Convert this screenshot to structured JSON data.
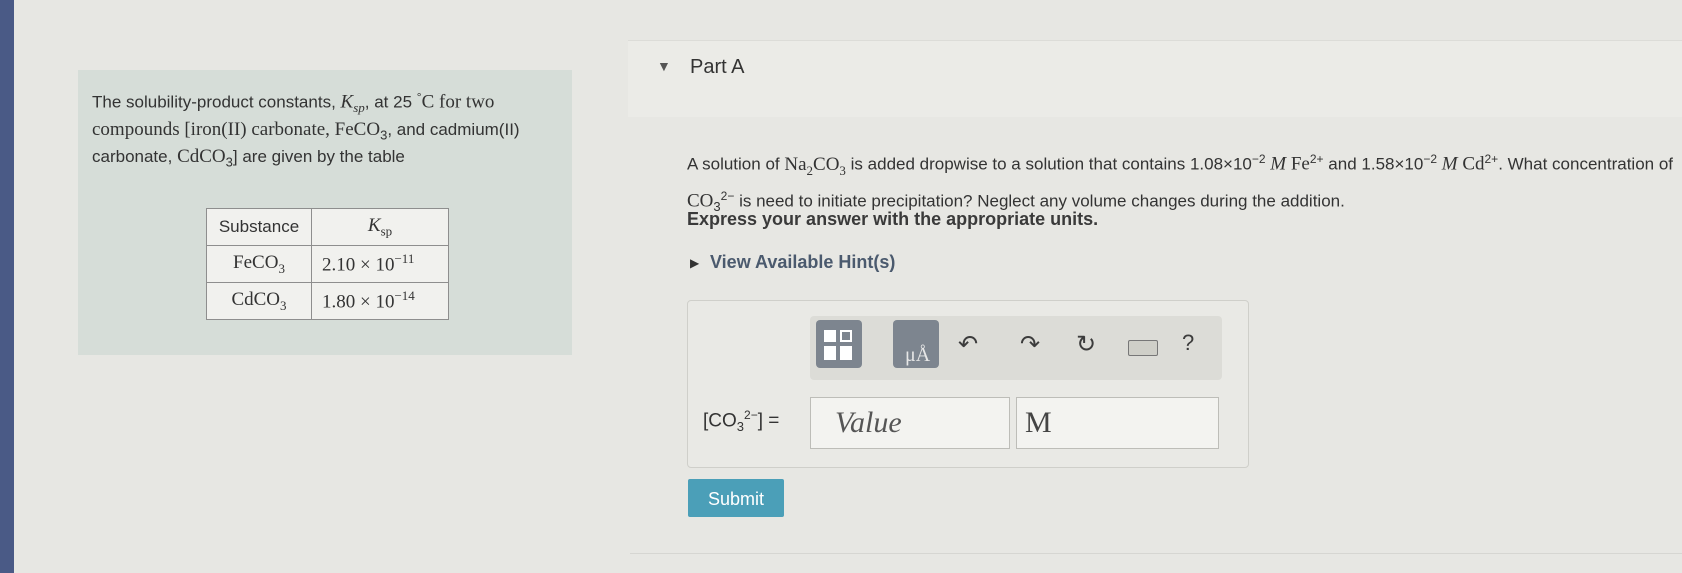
{
  "intro": {
    "text_1": "The solubility-product constants,",
    "ksp_k": "K",
    "ksp_sub": "sp",
    "text_2": ", at 25",
    "deg": "°",
    "unit_c": "C for two compounds [iron(II) carbonate,",
    "feco3": "FeCO",
    "sub3": "3",
    "text_3": ", and cadmium(II) carbonate,",
    "cdco3": "CdCO",
    "text_4": "] are given by the table"
  },
  "table": {
    "header_substance": "Substance",
    "header_ksp_k": "K",
    "header_ksp_sub": "sp",
    "rows": [
      {
        "formula": "FeCO",
        "sub": "3",
        "mantissa": "2.10 × 10",
        "exp": "−11"
      },
      {
        "formula": "CdCO",
        "sub": "3",
        "mantissa": "1.80 × 10",
        "exp": "−14"
      }
    ]
  },
  "part": {
    "title": "Part A"
  },
  "question": {
    "t1": "A solution of",
    "na2co3_a": "Na",
    "na2co3_b": "2",
    "na2co3_c": "CO",
    "na2co3_d": "3",
    "t2": "is added dropwise to a solution that contains",
    "c1": "1.08×10",
    "c1exp": "−2",
    "M": "M",
    "fe": "Fe",
    "fe_charge": "2+",
    "t3": "and",
    "c2": "1.58×10",
    "c2exp": "−2",
    "cd": "Cd",
    "cd_charge": "2+",
    "t4": ". What concentration of",
    "co3": "CO",
    "co3_sub": "3",
    "co3_charge": "2−",
    "t5": "is need to initiate precipitation? Neglect any volume changes during the addition."
  },
  "express": "Express your answer with the appropriate units.",
  "hint_link": "View Available Hint(s)",
  "toolbar": {
    "mu_button": "μÅ",
    "icons": [
      "templates-icon",
      "units-icon",
      "undo-icon",
      "redo-icon",
      "reset-icon",
      "keyboard-icon",
      "help-icon"
    ],
    "help": "?"
  },
  "answer": {
    "label_open": "[CO",
    "label_sub": "3",
    "label_sup": "2−",
    "label_close": "] =",
    "value_placeholder": "Value",
    "unit_value": "M"
  },
  "submit": "Submit",
  "colors": {
    "submit": "#4b9fb8",
    "toolbar_button": "#7d858f",
    "panel": "#d6ddd8"
  }
}
